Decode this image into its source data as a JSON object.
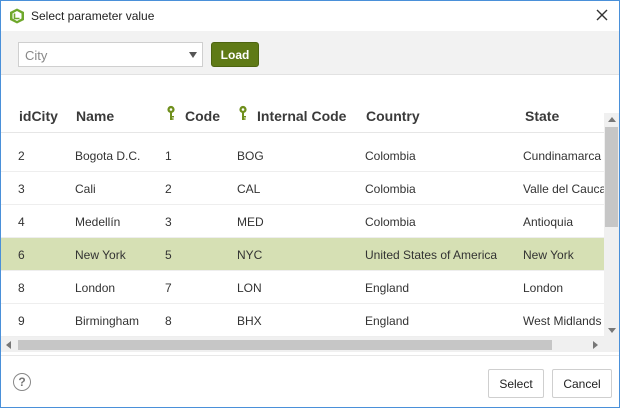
{
  "window": {
    "title": "Select parameter value"
  },
  "toolbar": {
    "selector": {
      "value": "City"
    },
    "load_label": "Load"
  },
  "grid": {
    "columns": [
      "idCity",
      "Name",
      "Code",
      "Internal Code",
      "Country",
      "State"
    ],
    "rows": [
      {
        "idCity": "2",
        "name": "Bogota D.C.",
        "code": "1",
        "internal_code": "BOG",
        "country": "Colombia",
        "state": "Cundinamarca"
      },
      {
        "idCity": "3",
        "name": "Cali",
        "code": "2",
        "internal_code": "CAL",
        "country": "Colombia",
        "state": "Valle del Cauca"
      },
      {
        "idCity": "4",
        "name": "Medellín",
        "code": "3",
        "internal_code": "MED",
        "country": "Colombia",
        "state": "Antioquia"
      },
      {
        "idCity": "6",
        "name": "New York",
        "code": "5",
        "internal_code": "NYC",
        "country": "United States of America",
        "state": "New York"
      },
      {
        "idCity": "8",
        "name": "London",
        "code": "7",
        "internal_code": "LON",
        "country": "England",
        "state": "London"
      },
      {
        "idCity": "9",
        "name": "Birmingham",
        "code": "8",
        "internal_code": "BHX",
        "country": "England",
        "state": "West Midlands"
      }
    ],
    "selected_row": 3
  },
  "footer": {
    "help_glyph": "?",
    "select_label": "Select",
    "cancel_label": "Cancel"
  },
  "colors": {
    "accent": "#5f7a16",
    "selected_row": "#d6e0b4",
    "key_icon": "#6f8f1c",
    "window_border": "#4a90d9"
  },
  "icons": {
    "app": "app-logo-icon",
    "close": "close-icon",
    "key": "key-icon",
    "help": "help-icon"
  }
}
